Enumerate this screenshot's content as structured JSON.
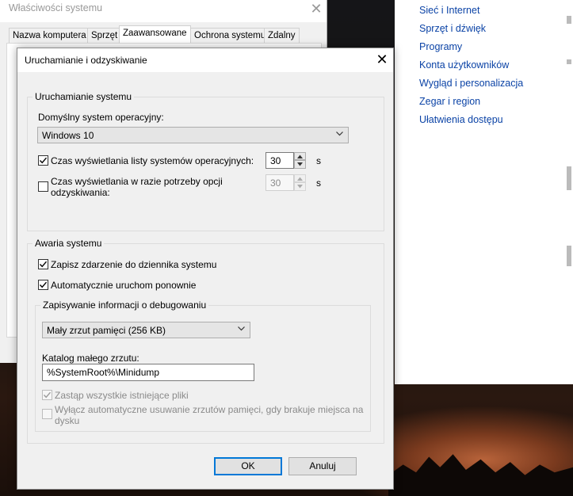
{
  "control_panel": {
    "links": [
      "Sieć i Internet",
      "Sprzęt i dźwięk",
      "Programy",
      "Konta użytkowników",
      "Wygląd i personalizacja",
      "Zegar i region",
      "Ułatwienia dostępu"
    ]
  },
  "system_properties": {
    "title": "Właściwości systemu",
    "tabs": [
      "Nazwa komputera",
      "Sprzęt",
      "Zaawansowane",
      "Ochrona systemu",
      "Zdalny"
    ],
    "active_tab": "Zaawansowane"
  },
  "dialog": {
    "title": "Uruchamianie i odzyskiwanie",
    "startup": {
      "legend": "Uruchamianie systemu",
      "default_os_label": "Domyślny system operacyjny:",
      "default_os_value": "Windows 10",
      "show_list_label": "Czas wyświetlania listy systemów operacyjnych:",
      "show_list_checked": true,
      "show_list_value": "30",
      "show_recovery_label_1": "Czas wyświetlania w razie potrzeby opcji",
      "show_recovery_label_2": "odzyskiwania:",
      "show_recovery_checked": false,
      "show_recovery_value": "30",
      "unit": "s"
    },
    "failure": {
      "legend": "Awaria systemu",
      "write_event_label": "Zapisz zdarzenie do dziennika systemu",
      "write_event_checked": true,
      "auto_restart_label": "Automatycznie uruchom ponownie",
      "auto_restart_checked": true,
      "debug": {
        "legend": "Zapisywanie informacji o debugowaniu",
        "dump_type": "Mały zrzut pamięci (256 KB)",
        "dir_label": "Katalog małego zrzutu:",
        "dir_value": "%SystemRoot%\\Minidump",
        "overwrite_label": "Zastąp wszystkie istniejące pliki",
        "overwrite_checked": true,
        "disable_auto_delete_label_1": "Wyłącz automatyczne usuwanie zrzutów pamięci, gdy brakuje miejsca na",
        "disable_auto_delete_label_2": "dysku",
        "disable_auto_delete_checked": false
      }
    },
    "ok_label": "OK",
    "cancel_label": "Anuluj"
  },
  "colors": {
    "link": "#0b43a6",
    "accent": "#0078d7"
  }
}
